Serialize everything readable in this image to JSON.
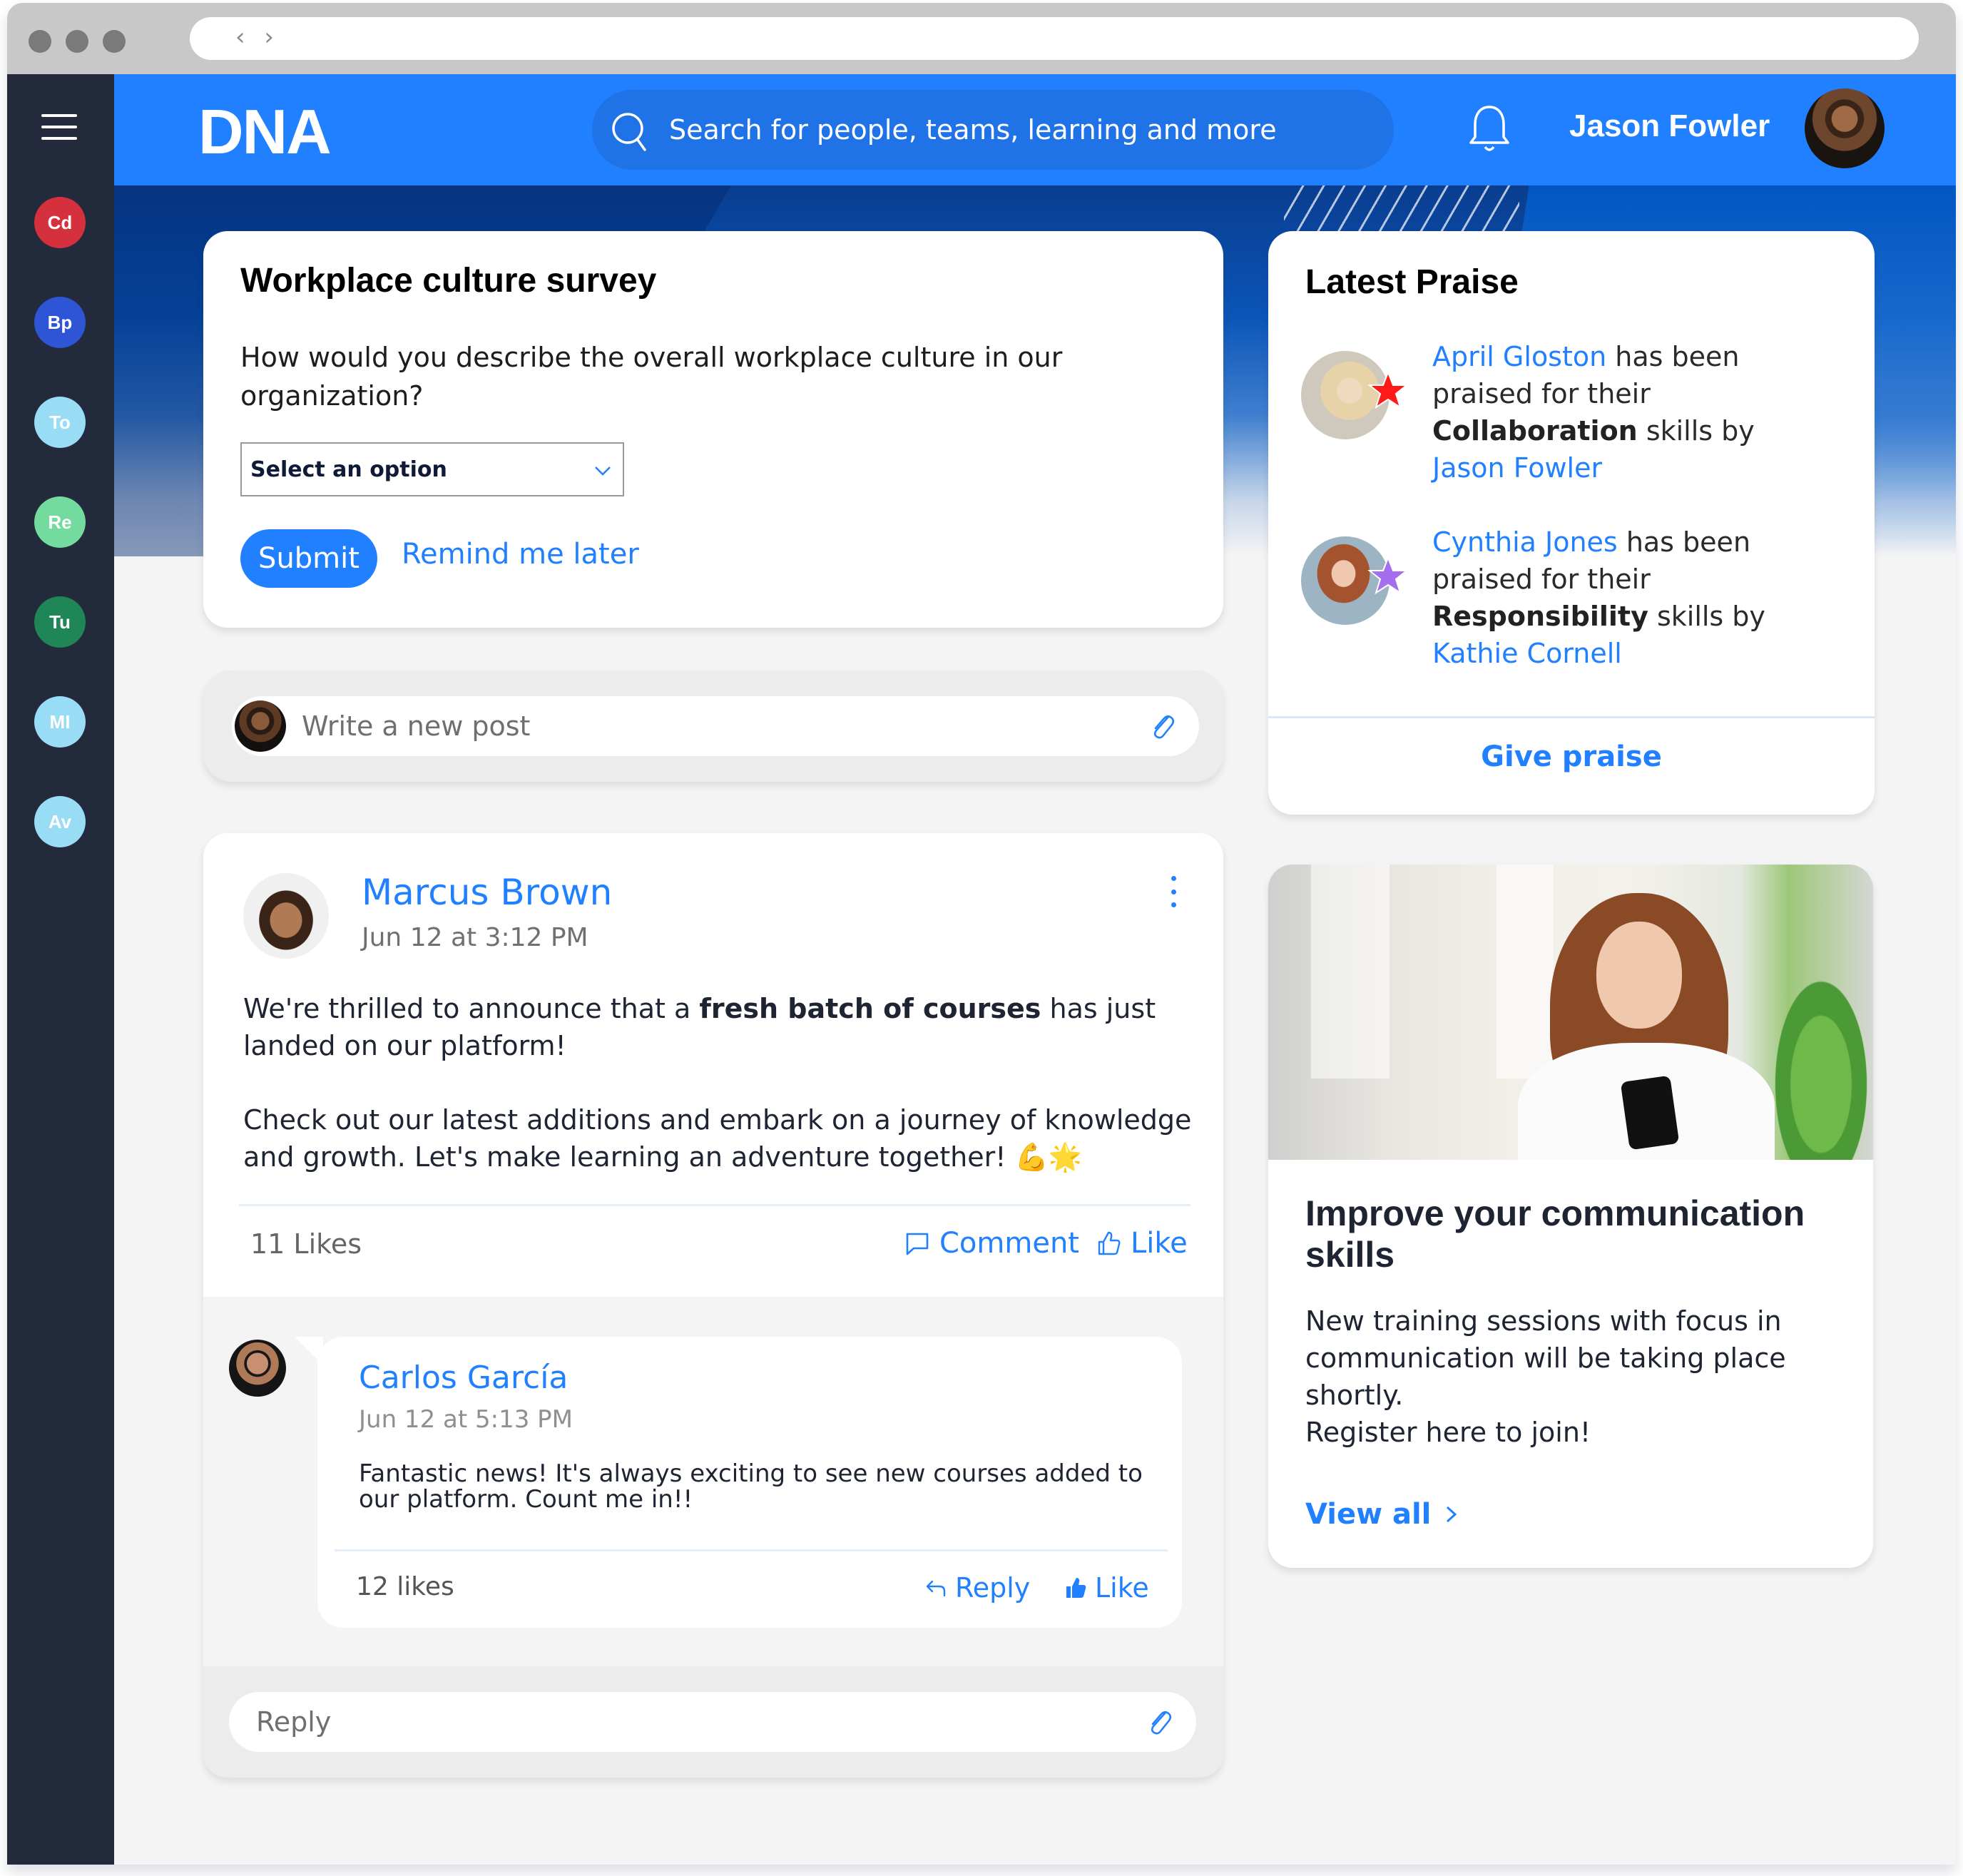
{
  "browser": {
    "nav_arrows": "‹ ›"
  },
  "sidebar": {
    "menu_icon": "hamburger-icon",
    "items": [
      {
        "initials": "Cd",
        "color": "#d5303e"
      },
      {
        "initials": "Bp",
        "color": "#2e55d6"
      },
      {
        "initials": "To",
        "color": "#99dcf6"
      },
      {
        "initials": "Re",
        "color": "#74db9f"
      },
      {
        "initials": "Tu",
        "color": "#1e8657"
      },
      {
        "initials": "MI",
        "color": "#99dcf6"
      },
      {
        "initials": "Av",
        "color": "#99dcf6"
      }
    ]
  },
  "header": {
    "logo": "DNA",
    "search_placeholder": "Search for people, teams, learning and more",
    "notification_icon": "bell-icon",
    "user_name": "Jason Fowler"
  },
  "colors": {
    "brand_blue": "#2180ff",
    "sidebar_bg": "#232a3b",
    "page_bg": "#f4f4f4"
  },
  "survey": {
    "title": "Workplace culture survey",
    "question": "How would you describe the overall workplace culture in our organization?",
    "select_value": "Select an option",
    "submit_label": "Submit",
    "remind_label": "Remind me later"
  },
  "composer": {
    "placeholder": "Write a new post"
  },
  "post": {
    "author": "Marcus Brown",
    "time": "Jun 12 at 3:12 PM",
    "body_part1": "We're thrilled to announce that a ",
    "body_bold": "fresh batch of courses",
    "body_part2": " has just landed on our platform!",
    "body_para2": "Check out our latest additions and embark on a journey of knowledge and growth. Let's make learning an adventure together! 💪🌟",
    "likes": "11 Likes",
    "comment_label": "Comment",
    "like_label": "Like",
    "comment": {
      "author": "Carlos García",
      "time": "Jun 12 at 5:13 PM",
      "text": "Fantastic news! It's always exciting to see new courses added to our platform. Count me in!!",
      "likes": "12 likes",
      "reply_label": "Reply",
      "like_label": "Like"
    },
    "reply_placeholder": "Reply"
  },
  "praise": {
    "title": "Latest Praise",
    "items": [
      {
        "recipient": "April Gloston",
        "text1": " has been praised for their ",
        "skill": "Collaboration",
        "text2": " skills by ",
        "giver": "Jason Fowler",
        "star_color": "#ff1a1a"
      },
      {
        "recipient": "Cynthia Jones",
        "text1": " has been praised for their ",
        "skill": "Responsibility",
        "text2": " skills by ",
        "giver": "Kathie Cornell",
        "star_color": "#a56ef0"
      }
    ],
    "give_label": "Give praise"
  },
  "learning": {
    "title": "Improve your communication skills",
    "description_line1": "New training sessions with focus in communication will be taking place shortly.",
    "description_line2": "Register here to join!",
    "view_all_label": "View all"
  }
}
